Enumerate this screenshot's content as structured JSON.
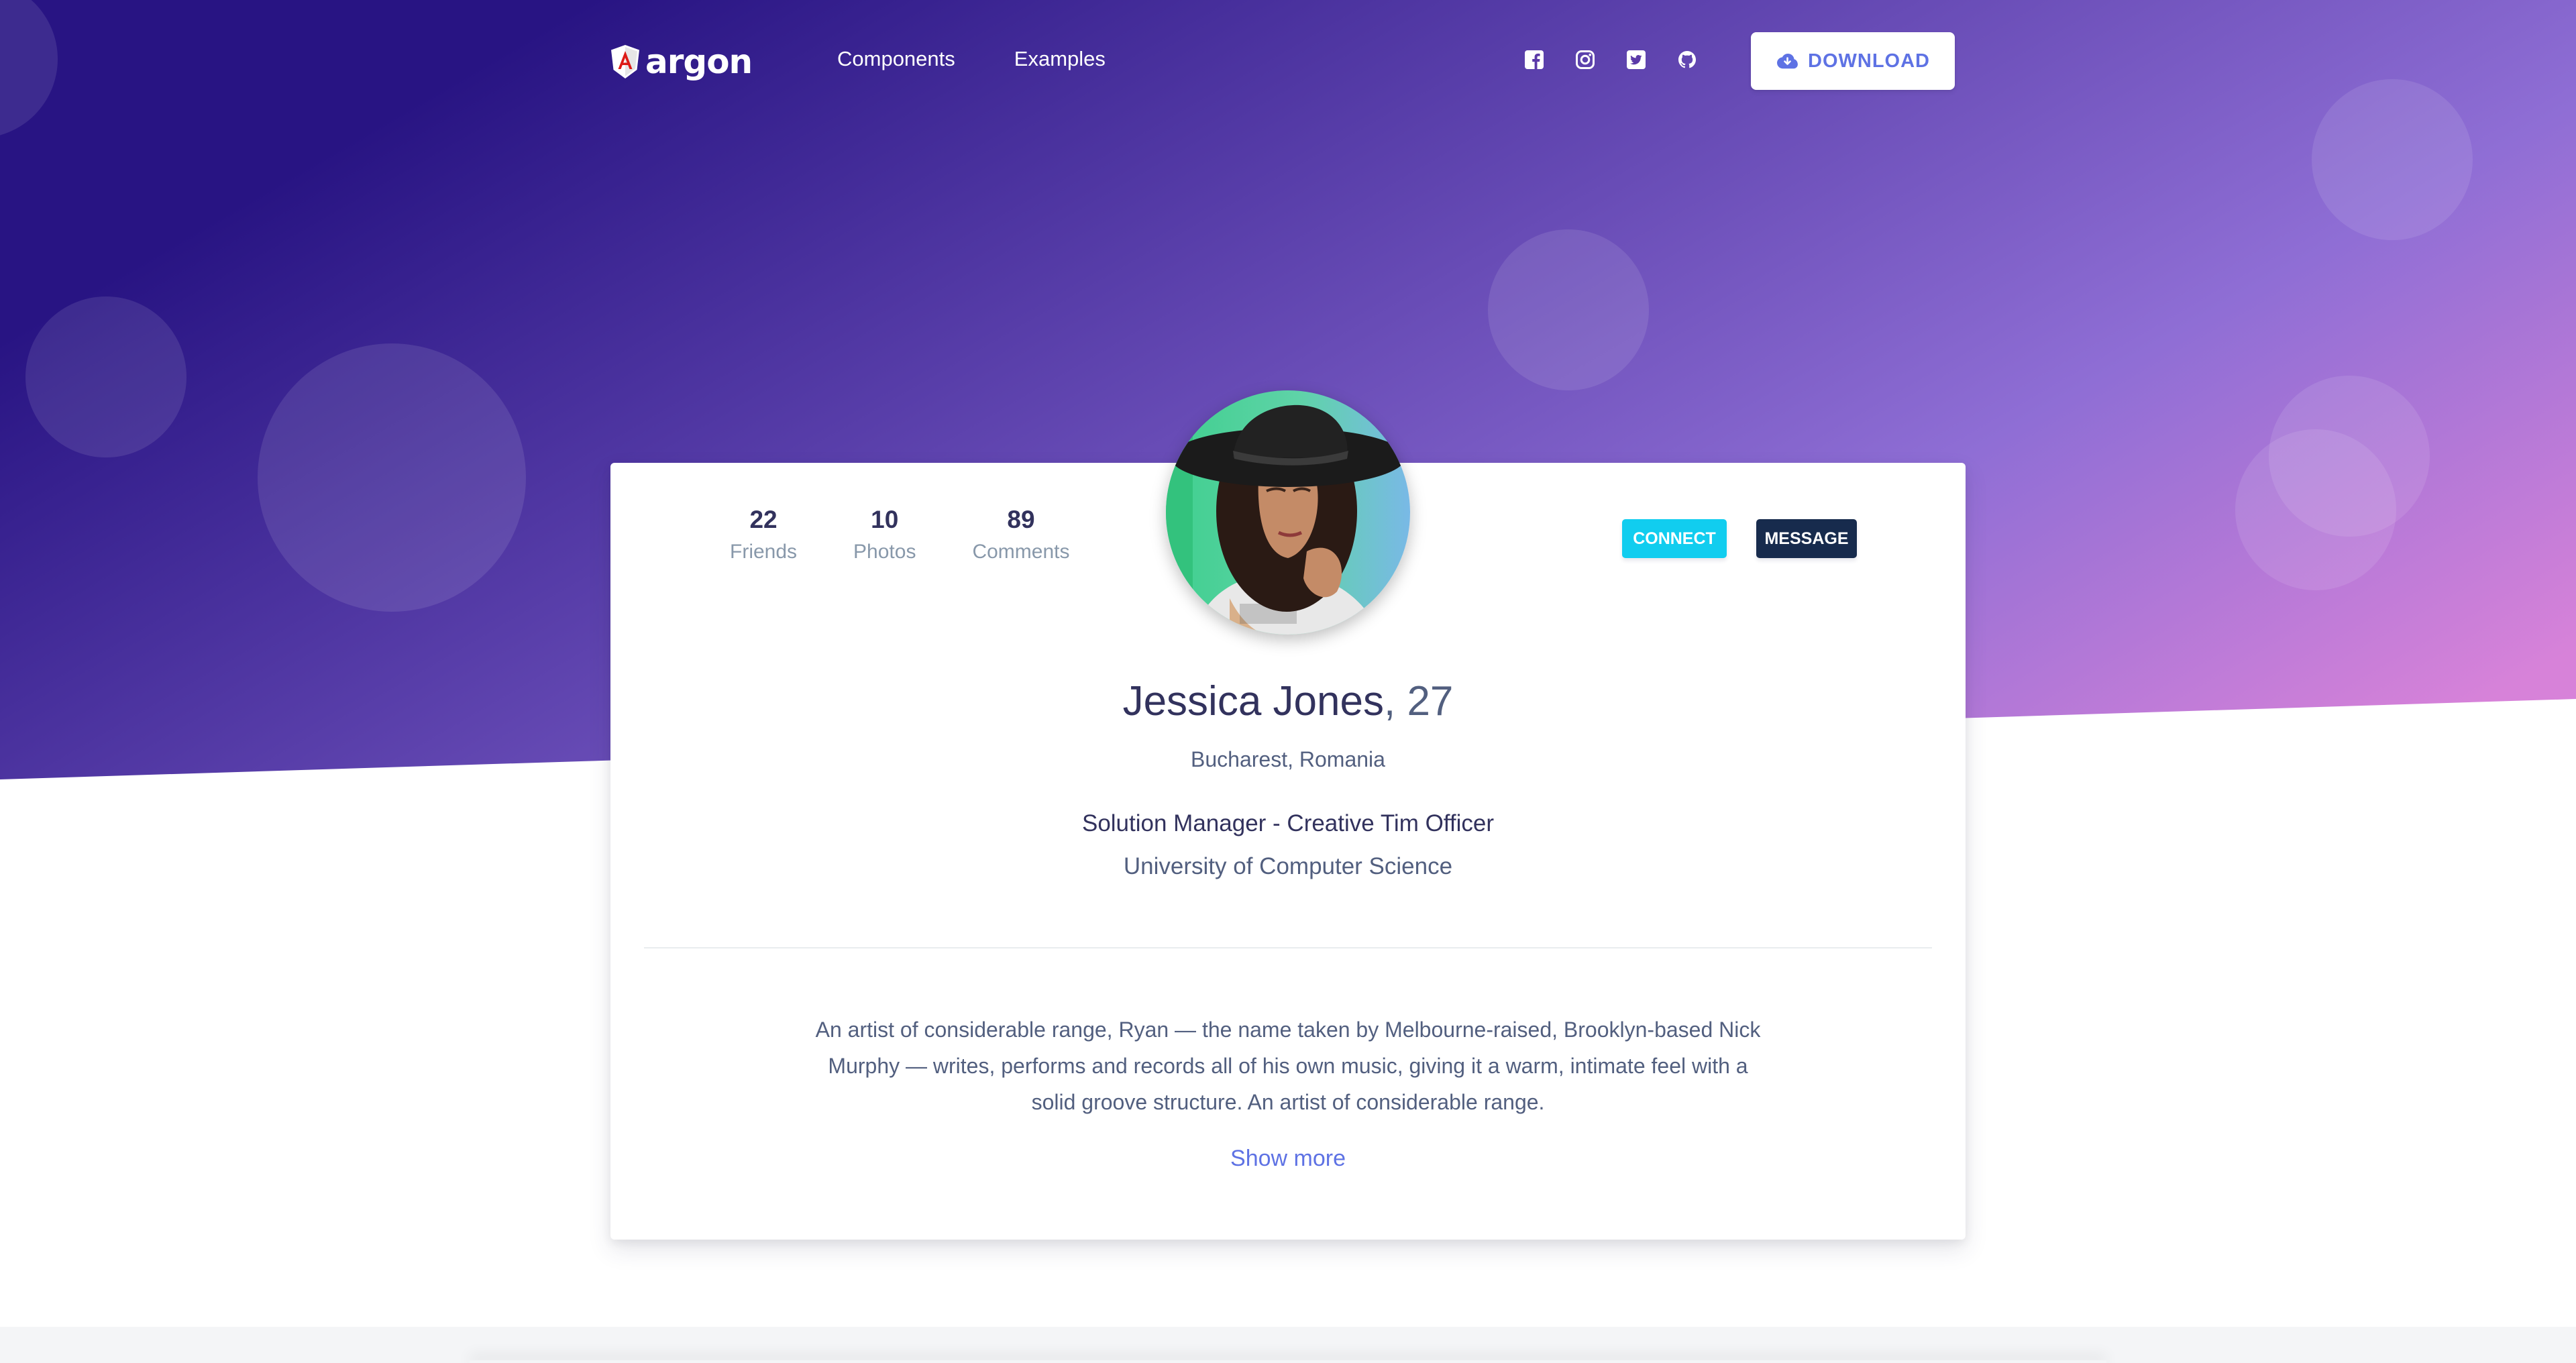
{
  "brand": {
    "name": "argon",
    "icon": "angular-shield-icon"
  },
  "nav": {
    "links": [
      "Components",
      "Examples"
    ]
  },
  "social": {
    "icons": [
      "facebook-icon",
      "instagram-icon",
      "twitter-icon",
      "github-icon"
    ]
  },
  "download": {
    "label": "DOWNLOAD",
    "icon": "cloud-download-icon"
  },
  "profile": {
    "stats": [
      {
        "value": "22",
        "label": "Friends"
      },
      {
        "value": "10",
        "label": "Photos"
      },
      {
        "value": "89",
        "label": "Comments"
      }
    ],
    "connect_label": "CONNECT",
    "message_label": "MESSAGE",
    "name": "Jessica Jones",
    "age": ", 27",
    "location": "Bucharest, Romania",
    "job": "Solution Manager - Creative Tim Officer",
    "school": "University of Computer Science",
    "bio": "An artist of considerable range, Ryan — the name taken by Melbourne-raised, Brooklyn-based Nick Murphy — writes, performs and records all of his own music, giving it a warm, intimate feel with a solid groove structure. An artist of considerable range.",
    "show_more": "Show more"
  },
  "colors": {
    "primary": "#5e72e4",
    "info": "#11cdef",
    "dark": "#172b4d",
    "heading": "#32325d",
    "text": "#525f7f",
    "muted": "#8898aa",
    "gradient_start": "#281483",
    "gradient_mid": "#8f6ed5",
    "gradient_end": "#d782d9"
  }
}
